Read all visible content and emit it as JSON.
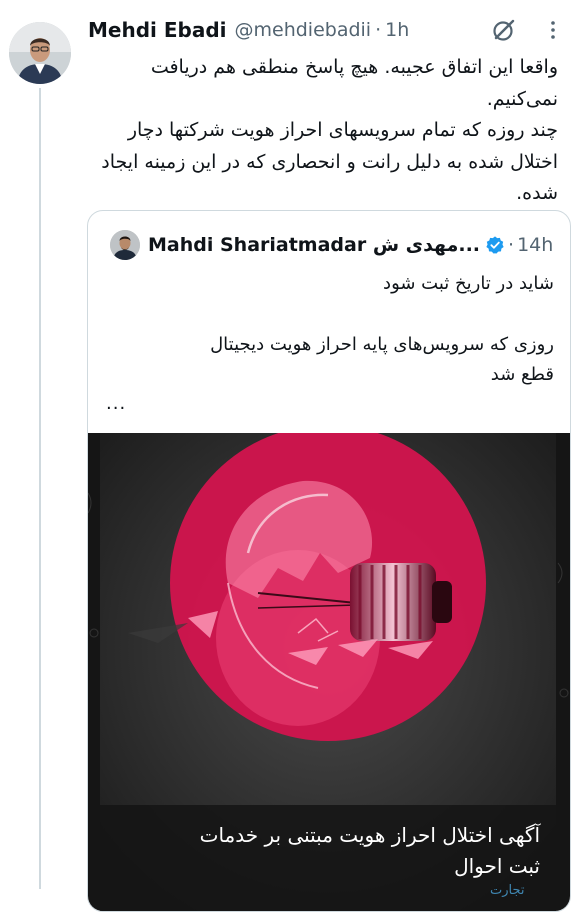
{
  "tweet": {
    "author_name": "Mehdi Ebadi",
    "handle": "@mehdiebadii",
    "separator": "·",
    "time": "1h",
    "lines": [
      "واقعا این اتفاق عجیبه. هیچ پاسخ منطقی هم دریافت",
      "نمی‌کنیم.",
      "چند روزه که تمام سرویسهای احراز هویت شرکتها دچار",
      "اختلال شده به دلیل رانت و انحصاری که در این زمینه ایجاد",
      "شده."
    ]
  },
  "quote": {
    "author_name": "Mahdi Shariatmadar مهدی ش...",
    "separator": "·",
    "time": "14h",
    "lines": [
      "شاید در تاریخ ثبت شود",
      "روزی که سرویس‌های پایه احراز هویت دیجیتال",
      "قطع شد"
    ],
    "more": "...",
    "image": {
      "caption_lines": [
        "آگهی اختلال  احراز هویت مبتنی بر خدمات",
        "ثبت احوال"
      ],
      "watermark": "تجارت"
    }
  },
  "icons": [
    "grok-icon",
    "more-icon",
    "verified-icon"
  ],
  "colors": {
    "text": "#0f1419",
    "secondary": "#536471",
    "border": "#cfd9de",
    "verified": "#1d9bf0",
    "image_circle": "#d6134f"
  }
}
